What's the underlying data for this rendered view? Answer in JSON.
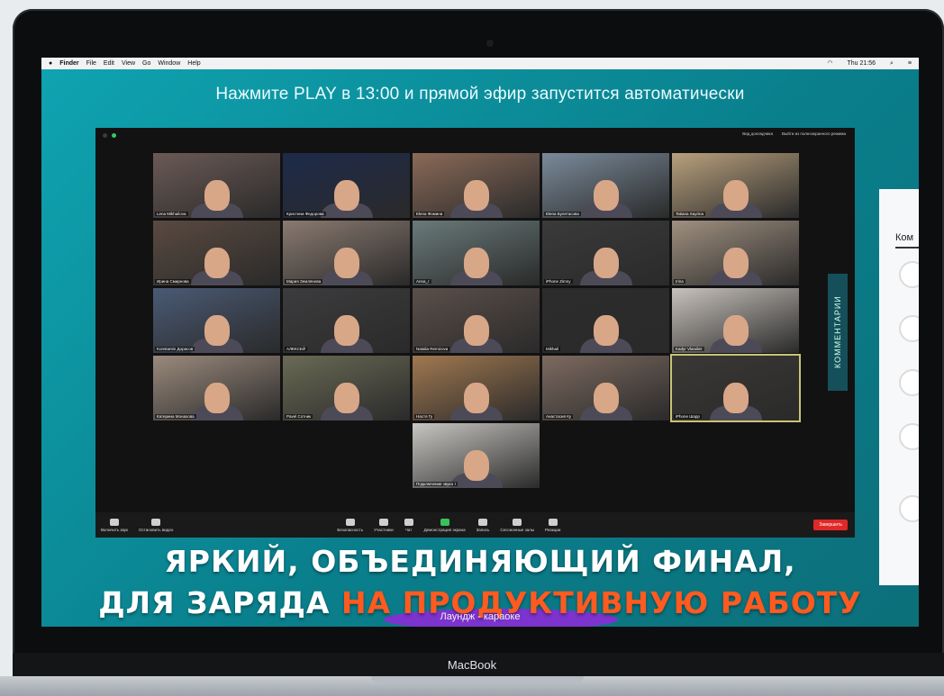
{
  "menubar": {
    "apple": "",
    "app": "Finder",
    "items": [
      "File",
      "Edit",
      "View",
      "Go",
      "Window",
      "Help"
    ],
    "clock": "Thu 21:56"
  },
  "headline": "Нажмите PLAY в 13:00 и прямой эфир запустится автоматически",
  "zoom": {
    "top_buttons": [
      "Вид докладчика",
      "Выйти из полноэкранного режима"
    ],
    "participants": [
      {
        "name": "Lena Mikhailova",
        "color": "#6b5a55"
      },
      {
        "name": "Кристина Федорова",
        "color": "#1d2a4a"
      },
      {
        "name": "Elena Фомина",
        "color": "#8a6a58"
      },
      {
        "name": "Elena Булетасова",
        "color": "#7a8a9a"
      },
      {
        "name": "Tatiana Sayrina",
        "color": "#b8a07d"
      },
      {
        "name": "Ирина Смирнова",
        "color": "#5a4a40"
      },
      {
        "name": "Мария Землянова",
        "color": "#8a7a70"
      },
      {
        "name": "Anna_r",
        "color": "#6a7a7a"
      },
      {
        "name": "iPhone Zimny",
        "color": "#3a3a3a"
      },
      {
        "name": "Irina",
        "color": "#a09080"
      },
      {
        "name": "Konstantin Дорасов",
        "color": "#4a5a75"
      },
      {
        "name": "АЛЕКСЕЙ",
        "color": "#3c3c3e"
      },
      {
        "name": "Natalia Remizova",
        "color": "#5b4f4a"
      },
      {
        "name": "Mikhail",
        "color": "#2c2c2c"
      },
      {
        "name": "Kadyr Vlandier",
        "color": "#c8c2bc"
      },
      {
        "name": "Катерина Монахова",
        "color": "#9b8a7c"
      },
      {
        "name": "Pavel Сотник",
        "color": "#6a6a55"
      },
      {
        "name": "Настя Гу",
        "color": "#a07850"
      },
      {
        "name": "Анастасия Ку",
        "color": "#7d6a60"
      },
      {
        "name": "iPhone Шарр",
        "color": "#3a3835"
      },
      {
        "name": "Подключение звука т",
        "color": "#c8c6c2"
      }
    ],
    "toolbar": [
      {
        "label": "Включить звук",
        "icon": "microphone-icon"
      },
      {
        "label": "Остановить видео",
        "icon": "camera-icon"
      },
      {
        "label": "Безопасность",
        "icon": "shield-icon"
      },
      {
        "label": "Участники",
        "icon": "participants-icon"
      },
      {
        "label": "Чат",
        "icon": "chat-icon"
      },
      {
        "label": "Демонстрация экрана",
        "icon": "share-screen-icon"
      },
      {
        "label": "Запись",
        "icon": "record-icon"
      },
      {
        "label": "Сессионные залы",
        "icon": "breakout-icon"
      },
      {
        "label": "Реакции",
        "icon": "reactions-icon"
      }
    ],
    "participants_count": "23",
    "end_label": "Завершить"
  },
  "side_label": "КОММЕНТАРИИ",
  "comments_title": "Ком",
  "banner": {
    "line1": "ЯРКИЙ, ОБЪЕДИНЯЮЩИЙ ФИНАЛ,",
    "line2_white": "ДЛЯ ЗАРЯДА ",
    "line2_orange": "НА ПРОДУКТИВНУЮ РАБОТУ",
    "caption": "Лаундж - караоке"
  },
  "brand": "MacBook",
  "colors": {
    "accent_orange": "#ff5a1f",
    "end_button": "#e02828",
    "teal_bg": "#0fa3b0"
  }
}
